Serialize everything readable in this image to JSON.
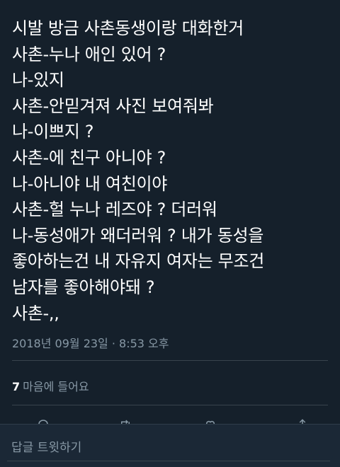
{
  "tweet": {
    "lines": [
      "시발 방금 사촌동생이랑 대화한거",
      "사촌-누나 애인 있어 ?",
      "나-있지",
      "사촌-안믿겨져 사진 보여줘봐",
      "나-이쁘지 ?",
      "사촌-에 친구 아니야 ?",
      "나-아니야 내 여친이야",
      "사촌-헐 누나 레즈야 ? 더러워",
      "나-동성애가 왜더러워 ? 내가 동성을",
      "좋아하는건 내 자유지 여자는 무조건",
      "남자를 좋아해야돼 ?",
      "사촌-,,"
    ],
    "timestamp": "2018년 09월 23일 · 8:53 오후"
  },
  "likes": {
    "count": "7",
    "label": "마음에 들어요"
  },
  "actions": {
    "icons": [
      "reply-icon",
      "retweet-icon",
      "like-icon",
      "share-icon"
    ]
  },
  "reply": {
    "placeholder": "답글 트윗하기"
  },
  "colors": {
    "background": "#15202b",
    "text": "#ffffff",
    "secondary_text": "#8899a6",
    "divider": "#38444d",
    "reply_bar": "#1b2836"
  }
}
